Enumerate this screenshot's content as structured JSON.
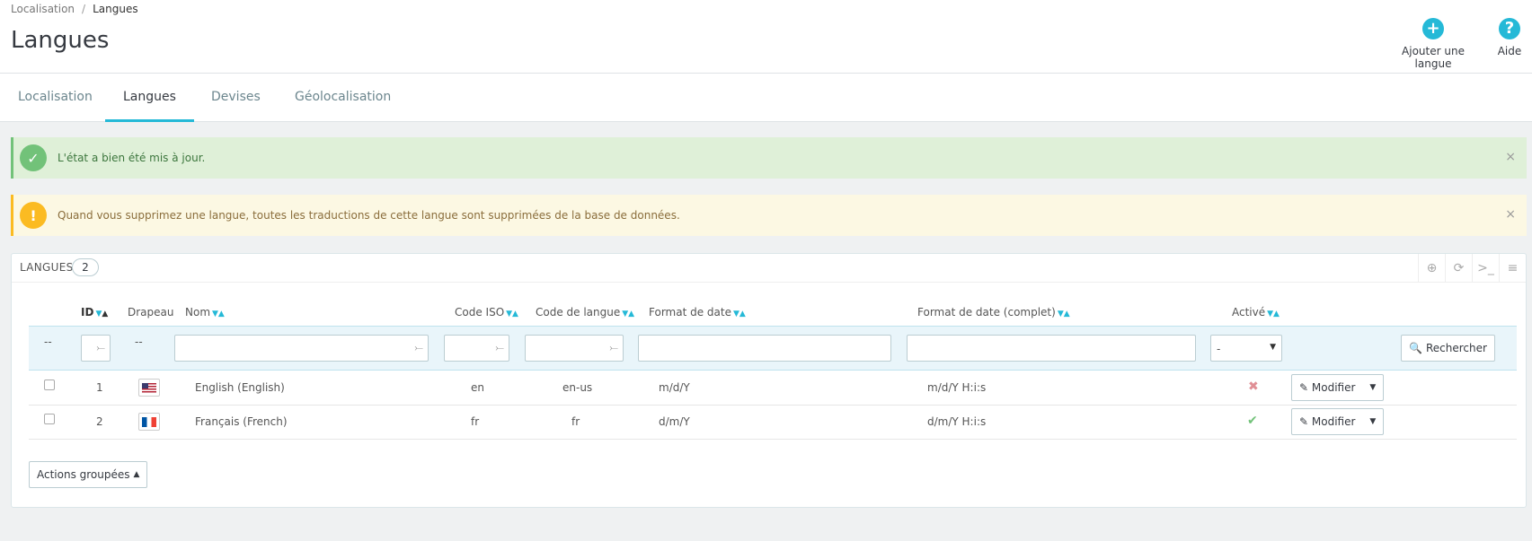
{
  "breadcrumb": {
    "parent": "Localisation",
    "separator": "/",
    "current": "Langues"
  },
  "page_title": "Langues",
  "toolbar": {
    "add_label": "Ajouter une langue",
    "add_icon": "plus-circle-icon",
    "help_label": "Aide",
    "help_icon": "question-circle-icon"
  },
  "tabs": [
    {
      "label": "Localisation",
      "active": false
    },
    {
      "label": "Langues",
      "active": true
    },
    {
      "label": "Devises",
      "active": false
    },
    {
      "label": "Géolocalisation",
      "active": false
    }
  ],
  "alerts": {
    "success": "L'état a bien été mis à jour.",
    "warning": "Quand vous supprimez une langue, toutes les traductions de cette langue sont supprimées de la base de données.",
    "close": "×"
  },
  "panel": {
    "title": "Langues",
    "count": "2"
  },
  "table": {
    "headers": [
      "ID",
      "Drapeau",
      "Nom",
      "Code ISO",
      "Code de langue",
      "Format de date",
      "Format de date (complet)",
      "Activé"
    ],
    "filters": {
      "id_dash": "--",
      "flag_dash": "--",
      "active_select": "-",
      "search_label": "Rechercher"
    },
    "rows": [
      {
        "id": "1",
        "flag": "us",
        "name": "English (English)",
        "iso": "en",
        "lang_code": "en-us",
        "date_format": "m/d/Y",
        "date_full": "m/d/Y H:i:s",
        "active": false,
        "active_glyph": "✖",
        "edit_label": "Modifier"
      },
      {
        "id": "2",
        "flag": "fr",
        "name": "Français (French)",
        "iso": "fr",
        "lang_code": "fr",
        "date_format": "d/m/Y",
        "date_full": "d/m/Y H:i:s",
        "active": true,
        "active_glyph": "✔",
        "edit_label": "Modifier"
      }
    ]
  },
  "bulk_actions": "Actions groupées",
  "colors": {
    "accent": "#25b9d7",
    "success": "#72c279",
    "warning": "#fbbb22",
    "error": "#e08f95"
  }
}
